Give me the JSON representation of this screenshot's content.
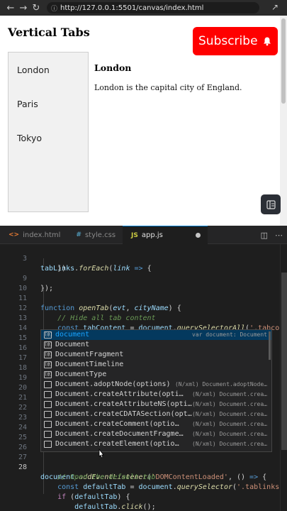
{
  "browser": {
    "url": "http://127.0.0.1:5501/canvas/index.html",
    "back_icon": "arrow-left-icon",
    "forward_icon": "arrow-right-icon",
    "reload_icon": "reload-icon",
    "external_icon": "open-external-icon"
  },
  "preview": {
    "title": "Vertical Tabs",
    "subscribe_label": "Subscribe",
    "subscribe_color": "#ff0000",
    "tabs": [
      "London",
      "Paris",
      "Tokyo"
    ],
    "content_heading": "London",
    "content_text": "London is the capital city of England."
  },
  "editor": {
    "tabs": [
      {
        "icon": "<>",
        "label": "index.html",
        "color": "#e37933"
      },
      {
        "icon": "#",
        "label": "style.css",
        "color": "#519aba"
      },
      {
        "icon": "JS",
        "label": "app.js",
        "color": "#cbcb41"
      }
    ],
    "accent": "#007acc"
  },
  "code": {
    "line_numbers": [
      "3",
      "9",
      "10",
      "11",
      "12",
      "13",
      "14",
      "15",
      "16",
      "17",
      "18",
      "19",
      "20",
      "21",
      "22",
      "23",
      "24",
      "25",
      "26",
      "27",
      "28"
    ]
  },
  "suggestions": [
    {
      "label": "document",
      "detail": "var document: Document"
    },
    {
      "label": "Document",
      "detail": ""
    },
    {
      "label": "DocumentFragment",
      "detail": ""
    },
    {
      "label": "DocumentTimeline",
      "detail": ""
    },
    {
      "label": "DocumentType",
      "detail": ""
    },
    {
      "label": "Document.adoptNode(options)",
      "detail": "(N/xml) Document.adoptNode…"
    },
    {
      "label": "Document.createAttribute(opti…",
      "detail": "(N/xml) Document.crea…"
    },
    {
      "label": "Document.createAttributeNS(opti…",
      "detail": "(N/xml) Document.crea…"
    },
    {
      "label": "Document.createCDATASection(opt…",
      "detail": "(N/xml) Document.crea…"
    },
    {
      "label": "Document.createComment(optio…",
      "detail": "(N/xml) Document.crea…"
    },
    {
      "label": "Document.createDocumentFragme…",
      "detail": "(N/xml) Document.crea…"
    },
    {
      "label": "Document.createElement(optio…",
      "detail": "(N/xml) Document.crea…"
    }
  ]
}
